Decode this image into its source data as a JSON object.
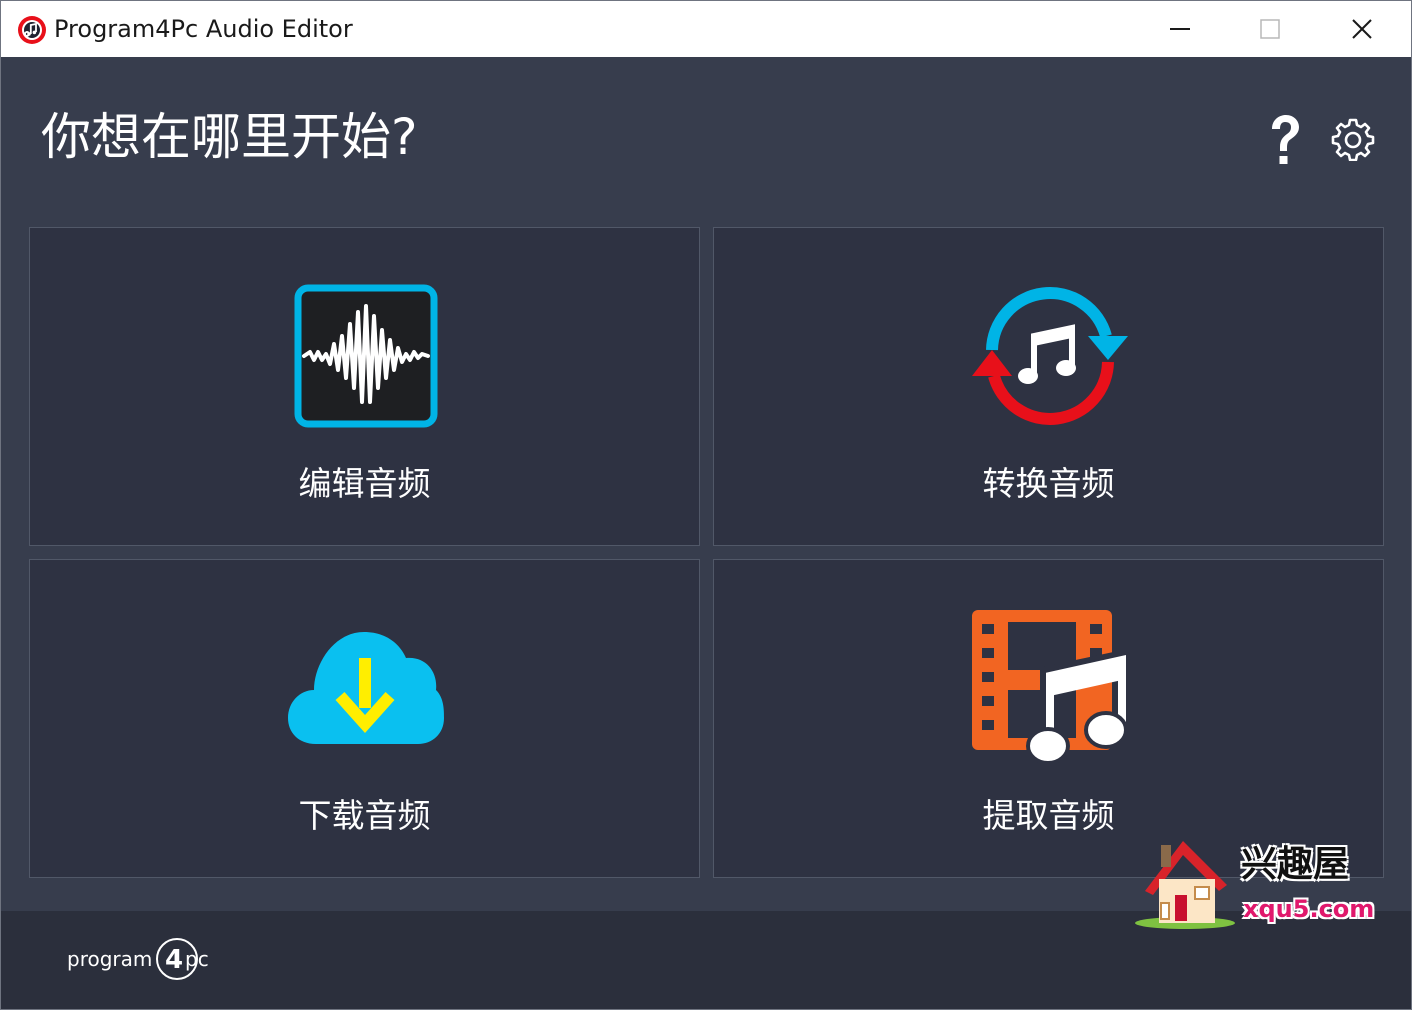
{
  "window": {
    "title": "Program4Pc Audio Editor"
  },
  "header": {
    "heading": "你想在哪里开始?",
    "help_icon": "question-mark-icon",
    "settings_icon": "gear-icon"
  },
  "tiles": [
    {
      "label": "编辑音频",
      "icon": "waveform-icon"
    },
    {
      "label": "转换音频",
      "icon": "convert-music-icon"
    },
    {
      "label": "下载音频",
      "icon": "cloud-download-icon"
    },
    {
      "label": "提取音频",
      "icon": "film-music-icon"
    }
  ],
  "footer": {
    "brand_text_left": "program",
    "brand_text_num": "4",
    "brand_text_right": "pc"
  },
  "watermark": {
    "text_cn": "兴趣屋",
    "text_en": "xqu5.com"
  },
  "colors": {
    "background": "#373d4d",
    "tile_background": "#2e3242",
    "footer_background": "#2b2f3c",
    "accent_blue": "#00b4e6",
    "accent_red": "#e8101a",
    "accent_orange": "#f26522",
    "accent_yellow": "#fff200"
  }
}
